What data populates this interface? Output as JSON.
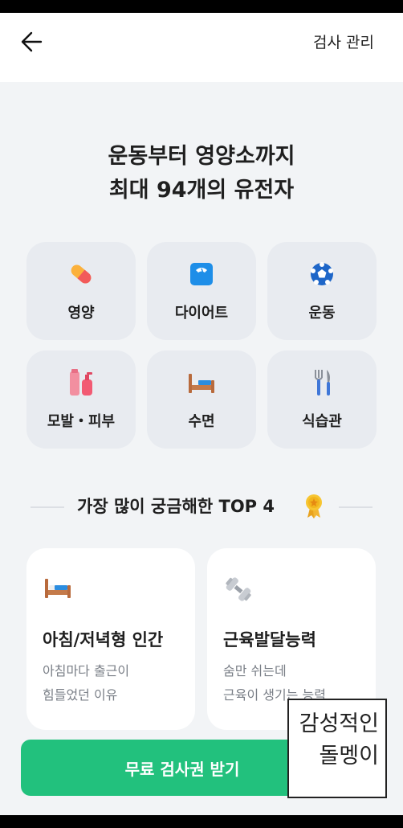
{
  "header": {
    "manage_label": "검사 관리"
  },
  "hero": {
    "line1": "운동부터 영양소까지",
    "line2": "최대 94개의 유전자"
  },
  "categories": [
    {
      "label": "영양",
      "icon": "pill-icon"
    },
    {
      "label": "다이어트",
      "icon": "scale-icon"
    },
    {
      "label": "운동",
      "icon": "soccer-ball-icon"
    },
    {
      "label": "모발・피부",
      "icon": "cosmetics-icon"
    },
    {
      "label": "수면",
      "icon": "bed-icon"
    },
    {
      "label": "식습관",
      "icon": "fork-knife-icon"
    }
  ],
  "top4": {
    "title": "가장 많이 궁금해한 TOP 4",
    "cards": [
      {
        "title": "아침/저녁형 인간",
        "desc1": "아침마다 출근이",
        "desc2": "힘들었던 이유",
        "icon": "bed-icon"
      },
      {
        "title": "근육발달능력",
        "desc1": "숨만 쉬는데",
        "desc2": "근육이 생기는 능력",
        "icon": "dumbbell-icon"
      }
    ]
  },
  "cta": {
    "label": "무료 검사권 받기"
  },
  "watermark": {
    "line1": "감성적인",
    "line2": "돌멩이"
  },
  "colors": {
    "accent": "#22c17d",
    "background": "#f2f4f6",
    "tile": "#e8ebf0"
  }
}
